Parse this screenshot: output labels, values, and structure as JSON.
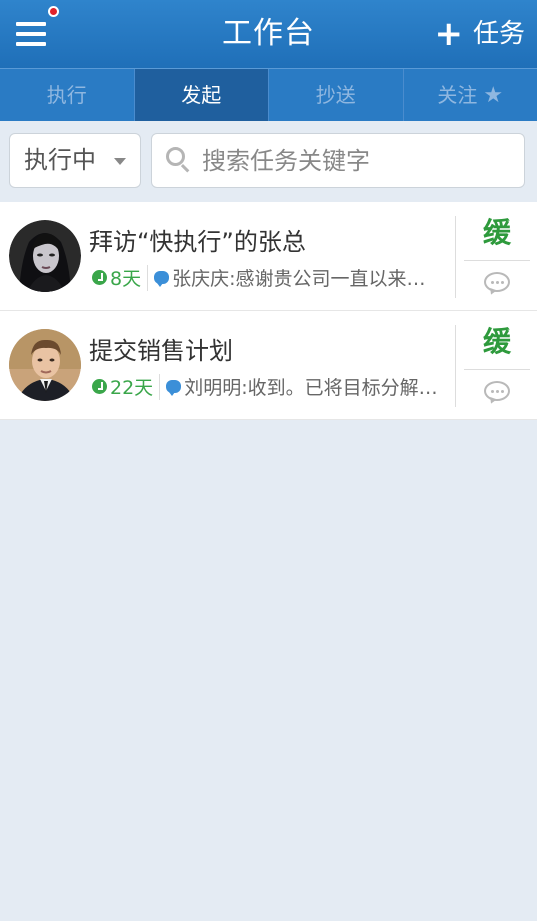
{
  "header": {
    "title": "工作台",
    "add_label": "任务",
    "colors": {
      "bar": "#2a7bc4",
      "notify_dot": "#e0222a"
    }
  },
  "tabs": [
    {
      "label": "执行",
      "active": false
    },
    {
      "label": "发起",
      "active": true
    },
    {
      "label": "抄送",
      "active": false
    },
    {
      "label": "关注",
      "active": false,
      "icon": "star-icon"
    }
  ],
  "filter": {
    "status_value": "执行中",
    "search_placeholder": "搜索任务关键字"
  },
  "tasks": [
    {
      "title": "拜访“快执行”的张总",
      "days": "8天",
      "last_message": "张庆庆:感谢贵公司一直以来的支持与合作",
      "priority": "缓",
      "avatar": "avatar-woman"
    },
    {
      "title": "提交销售计划",
      "days": "22天",
      "last_message": "刘明明:收到。已将目标分解到各区域",
      "priority": "缓",
      "avatar": "avatar-man"
    }
  ],
  "colors": {
    "accent_green": "#3aa64a",
    "accent_blue": "#3b8fd8",
    "background": "#e4ebf3"
  }
}
